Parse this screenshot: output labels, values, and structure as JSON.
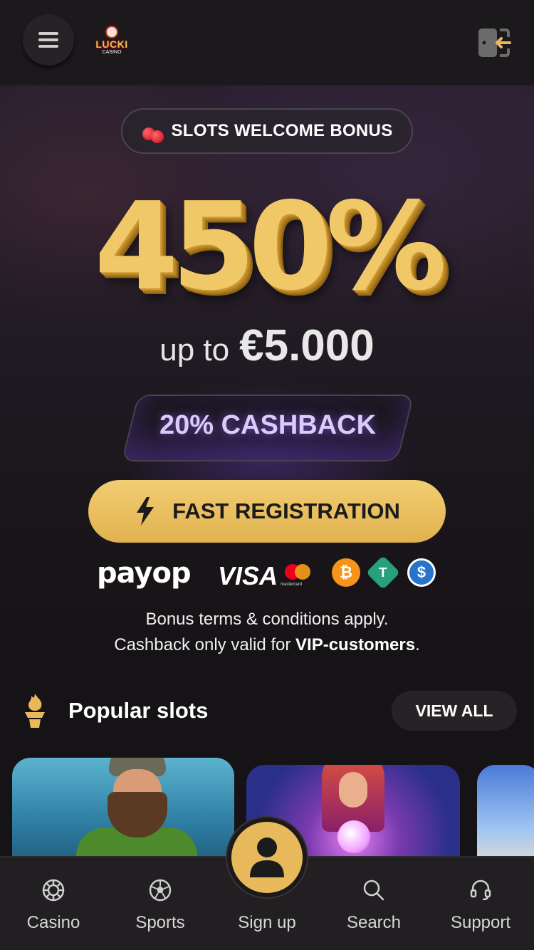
{
  "header": {
    "logo_text": "LUCKI",
    "logo_sub": "CASINO",
    "menu_icon": "hamburger-icon",
    "login_icon": "login-door-icon"
  },
  "hero": {
    "bonus_badge": "SLOTS WELCOME BONUS",
    "percentage": "450%",
    "up_to": "up to",
    "amount": "€5.000",
    "cashback": "20% CASHBACK",
    "cta_label": "FAST REGISTRATION",
    "terms_line1": "Bonus terms & conditions apply.",
    "terms_line2_prefix": "Cashback only valid for ",
    "terms_line2_bold": "VIP-customers",
    "terms_line2_suffix": "."
  },
  "payments": {
    "payop": "payop",
    "visa": "VISA",
    "mastercard": "mastercard",
    "btc_symbol": "₿",
    "usdt_symbol": "T",
    "usdc_symbol": "$"
  },
  "popular": {
    "title": "Popular slots",
    "view_all": "VIEW ALL"
  },
  "bottom_nav": [
    {
      "label": "Casino",
      "icon": "casino-chip-icon"
    },
    {
      "label": "Sports",
      "icon": "soccer-ball-icon"
    },
    {
      "label": "Sign up",
      "icon": "user-icon"
    },
    {
      "label": "Search",
      "icon": "search-icon"
    },
    {
      "label": "Support",
      "icon": "headset-icon"
    }
  ],
  "colors": {
    "accent_gold": "#e8b95a",
    "background": "#161316",
    "cashback_purple": "#d8cdfa"
  }
}
